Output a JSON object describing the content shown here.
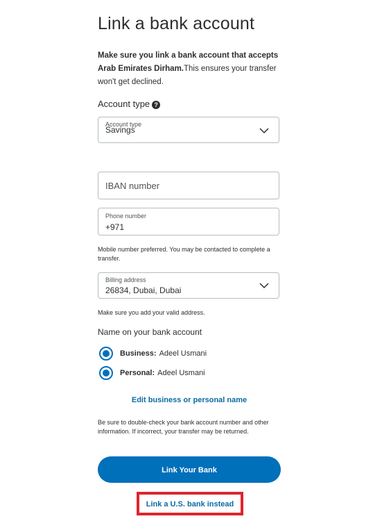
{
  "page": {
    "title": "Link a bank account",
    "intro_bold": "Make sure you link a bank account that accepts Arab Emirates Dirham.",
    "intro_rest": "This ensures your transfer won't get declined."
  },
  "account_type": {
    "section_label": "Account type",
    "help_icon": "?",
    "field_label": "Account type",
    "value": "Savings"
  },
  "iban": {
    "placeholder": "IBAN number"
  },
  "phone": {
    "label": "Phone number",
    "value": "+971",
    "note": "Mobile number preferred. You may be contacted to complete a transfer."
  },
  "billing": {
    "label": "Billing address",
    "value": "26834, Dubai, Dubai",
    "note": "Make sure you add your valid address."
  },
  "name_on_account": {
    "section_label": "Name on your bank account",
    "options": [
      {
        "type": "Business:",
        "name": "Adeel Usmani"
      },
      {
        "type": "Personal:",
        "name": "Adeel Usmani"
      }
    ],
    "edit_link": "Edit business or personal name"
  },
  "warning_note": "Be sure to double-check your bank account number and other information. If incorrect, your transfer may be returned.",
  "actions": {
    "link_bank": "Link Your Bank",
    "link_us_bank": "Link a U.S. bank instead"
  },
  "colors": {
    "accent": "#0070ba",
    "link": "#0a6aa5",
    "highlight": "#e0252b"
  }
}
